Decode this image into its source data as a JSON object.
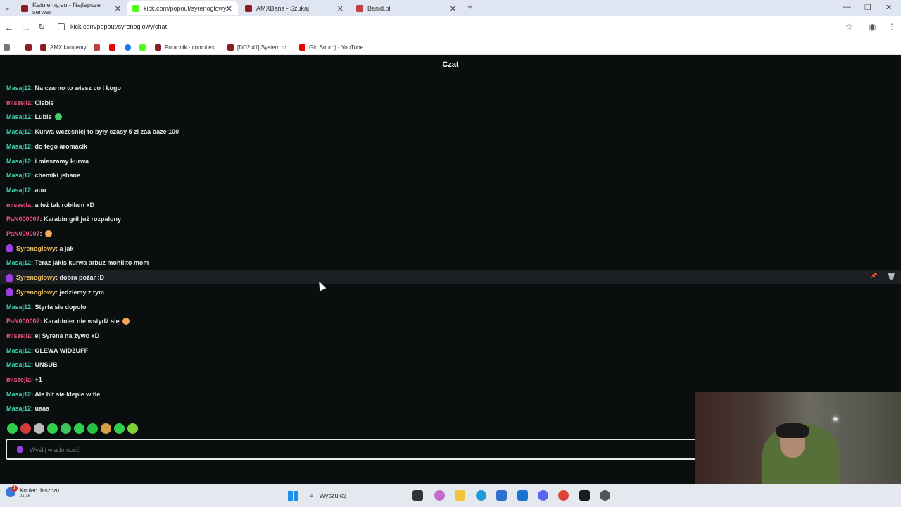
{
  "tabs": [
    {
      "title": "Katujemy.eu - Najlepsze serwer",
      "active": false
    },
    {
      "title": "kick.com/popout/syrenoglowy/",
      "active": true
    },
    {
      "title": "AMXBans - Szukaj",
      "active": false
    },
    {
      "title": "Banid.pl",
      "active": false
    }
  ],
  "address": {
    "url": "kick.com/popout/syrenoglowy/chat"
  },
  "bookmarks": [
    "AMX katujemy",
    "Poradnik - compl.ex...",
    "[DD2 #1] System ro...",
    "Gin Sour :) - YouTube"
  ],
  "chat": {
    "title": "Czat",
    "colors": {
      "Masaj12": "#3fd2a8",
      "miszejla": "#f0567e",
      "PaN000007": "#f0567e",
      "Syrenoglowy": "#f0c060"
    },
    "messages": [
      {
        "user": "Masaj12",
        "text": ": Na czarno to wiesz co i kogo"
      },
      {
        "user": "miszejla",
        "text": ": Ciebie"
      },
      {
        "user": "Masaj12",
        "text": ": Lubie",
        "emoji": "heart"
      },
      {
        "user": "Masaj12",
        "text": ": Kurwa wczesniej to były czasy 5 zl zaa baze 100"
      },
      {
        "user": "Masaj12",
        "text": ": do tego aromacik"
      },
      {
        "user": "Masaj12",
        "text": ": i mieszamy kurwa"
      },
      {
        "user": "Masaj12",
        "text": ": chemiki jebane"
      },
      {
        "user": "Masaj12",
        "text": ": auu"
      },
      {
        "user": "miszejla",
        "text": ": a też tak robiłam xD"
      },
      {
        "user": "PaN000007",
        "text": ": Karabin gril już rozpalony"
      },
      {
        "user": "PaN000007",
        "text": ":",
        "emoji": "grin"
      },
      {
        "user": "Syrenoglowy",
        "text": ": a jak",
        "badge": true
      },
      {
        "user": "Masaj12",
        "text": ": Teraz jakis kurwa arbuz mohilito mom"
      },
      {
        "user": "Syrenoglowy",
        "text": ": dobra pożar :D",
        "badge": true,
        "highlight": true
      },
      {
        "user": "Syrenoglowy",
        "text": ": jedziemy z tym",
        "badge": true
      },
      {
        "user": "Masaj12",
        "text": ": Styrta sie dopolo"
      },
      {
        "user": "PaN000007",
        "text": ": Karabinier nie wstydź się",
        "emoji": "grin"
      },
      {
        "user": "miszejla",
        "text": ": ej Syrena na żywo xD"
      },
      {
        "user": "Masaj12",
        "text": ": OLEWA WIDZUFF"
      },
      {
        "user": "Masaj12",
        "text": ": UNSUB"
      },
      {
        "user": "miszejla",
        "text": ": +1"
      },
      {
        "user": "Masaj12",
        "text": ": Ale bit sie klepie w tle"
      },
      {
        "user": "Masaj12",
        "text": ": uaaa"
      }
    ],
    "input_placeholder": "Wyślij wiadomość"
  },
  "taskbar": {
    "weather": "Koniec deszczu",
    "weather_time": "21:16",
    "notification_count": "1",
    "search_placeholder": "Wyszukaj"
  }
}
